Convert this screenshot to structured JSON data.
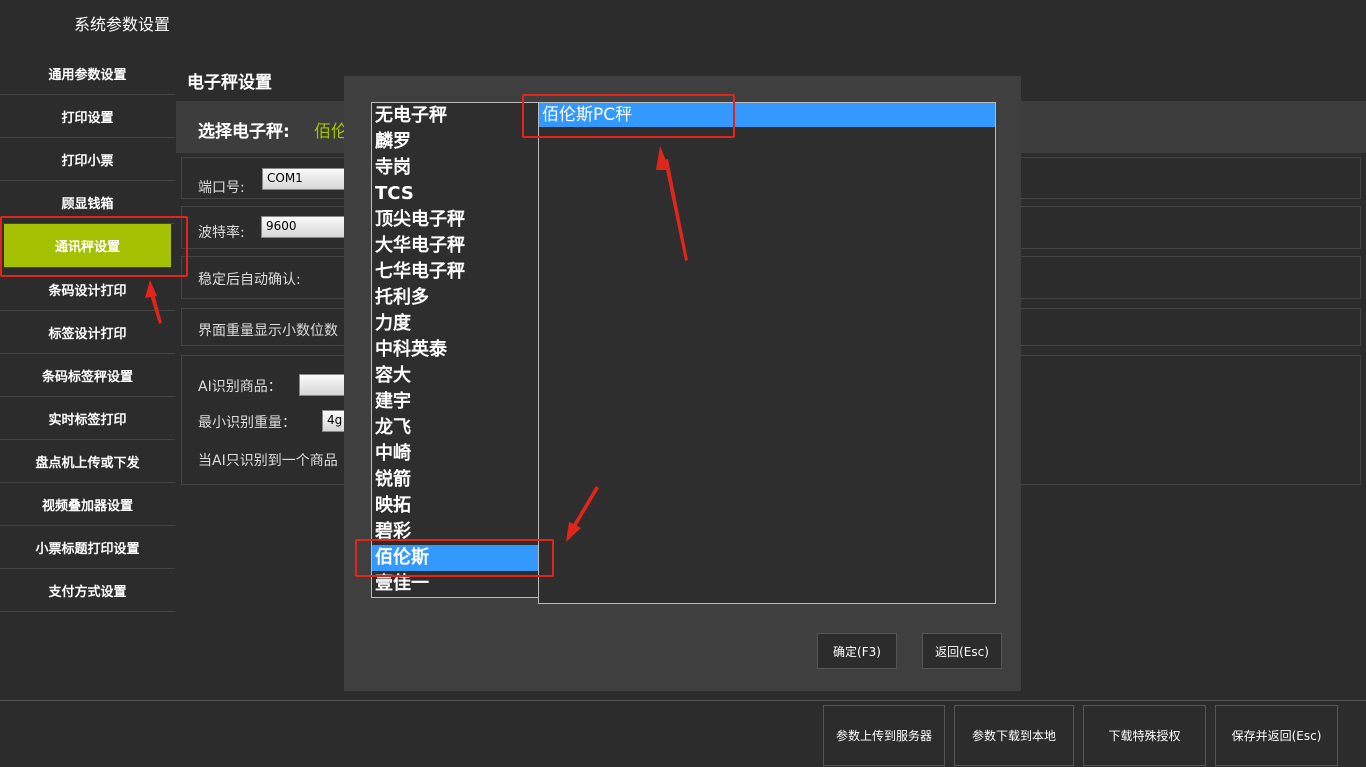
{
  "window": {
    "title": "系统参数设置"
  },
  "sidebar": {
    "items": [
      "通用参数设置",
      "打印设置",
      "打印小票",
      "顾显钱箱",
      "通讯秤设置",
      "条码设计打印",
      "标签设计打印",
      "条码标签秤设置",
      "实时标签打印",
      "盘点机上传或下发",
      "视频叠加器设置",
      "小票标题打印设置",
      "支付方式设置"
    ],
    "active_index": 4
  },
  "content": {
    "title": "电子秤设置",
    "select_label": "选择电子秤:",
    "select_value": "佰伦",
    "port_label": "端口号:",
    "port_value": "COM1",
    "baud_label": "波特率:",
    "baud_value": "9600",
    "stable_label": "稳定后自动确认:",
    "decimal_label": "界面重量显示小数位数",
    "ai_label": "AI识别商品：",
    "min_weight_label": "最小识别重量：",
    "min_weight_value": "4g",
    "ai_note": "当AI只识别到一个商品"
  },
  "dialog": {
    "brands": [
      "无电子秤",
      "麟罗",
      "寺岗",
      "TCS",
      "顶尖电子秤",
      "大华电子秤",
      "七华电子秤",
      "托利多",
      "力度",
      "中科英泰",
      "容大",
      "建宇",
      "龙飞",
      "中崎",
      "锐箭",
      "映拓",
      "碧彩",
      "佰伦斯",
      "壹佳一"
    ],
    "selected_brand_index": 17,
    "models": [
      "佰伦斯PC秤"
    ],
    "selected_model_index": 0,
    "ok_label": "确定(F3)",
    "back_label": "返回(Esc)"
  },
  "bottom": {
    "upload_label": "参数上传到服务器",
    "download_label": "参数下载到本地",
    "special_label": "下载特殊授权",
    "save_label": "保存并返回(Esc)"
  },
  "colors": {
    "accent": "#a3c100",
    "selection": "#3399ff",
    "highlight": "#e0261b"
  }
}
